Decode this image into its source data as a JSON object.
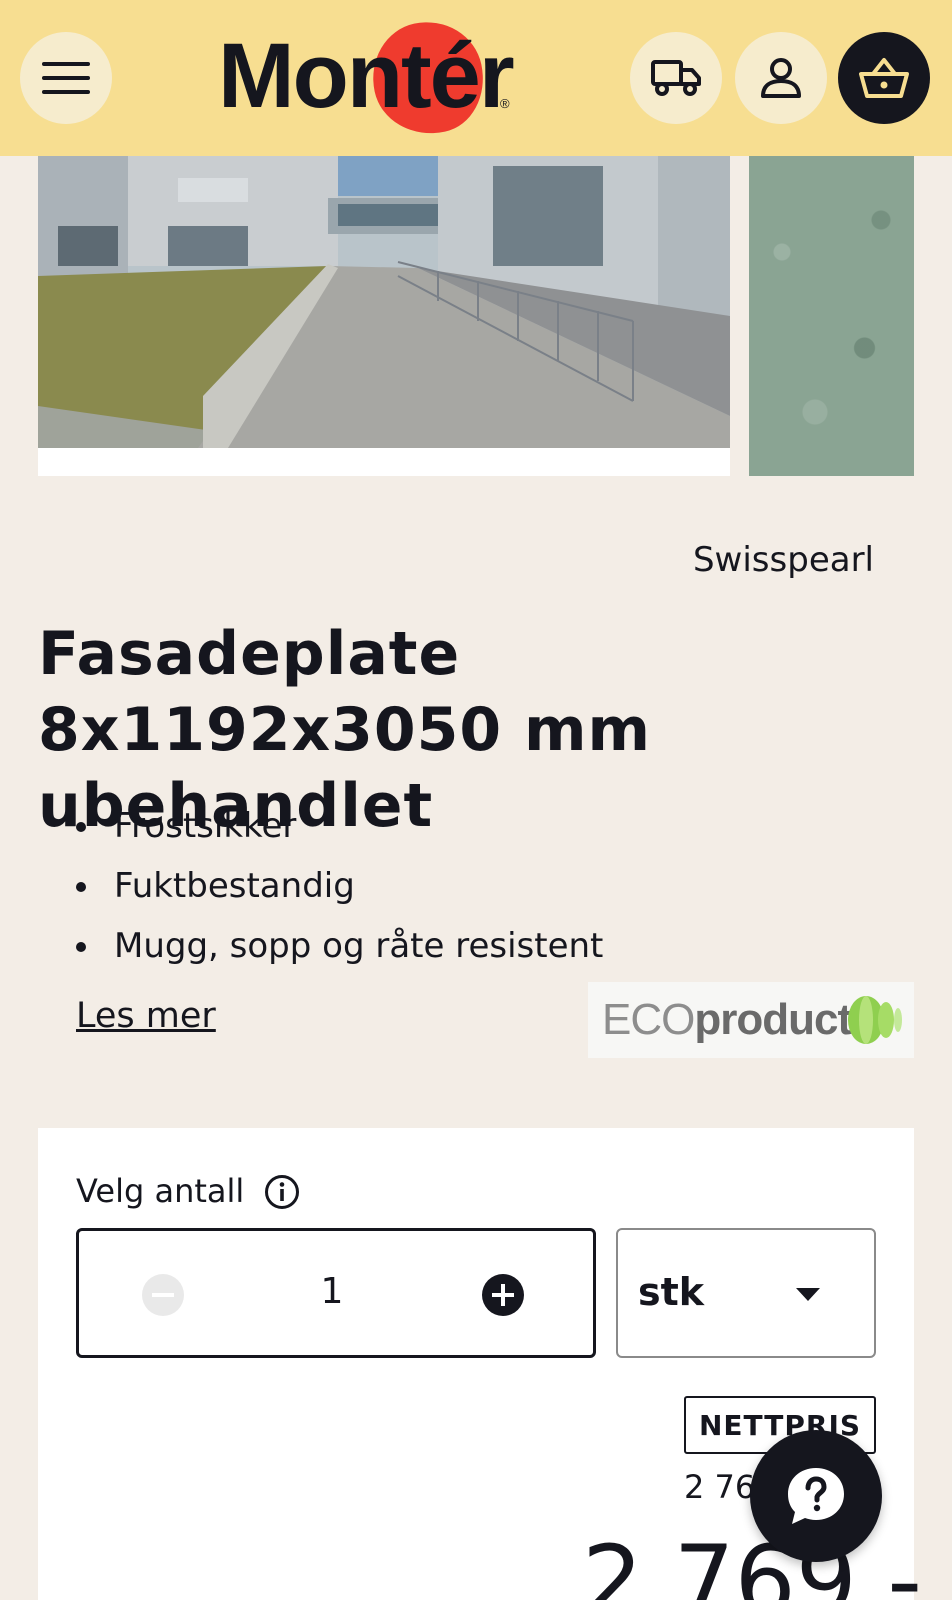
{
  "header": {
    "logo_text": "Montér",
    "logo_reg": "®",
    "menu_icon": "hamburger-icon",
    "delivery_icon": "truck-icon",
    "account_icon": "user-icon",
    "cart_icon": "basket-icon",
    "background": "#f7de91"
  },
  "gallery": {
    "images": [
      "building-photo",
      "texture-swatch"
    ]
  },
  "product": {
    "brand": "Swisspearl",
    "title": "Fasadeplate 8x1192x3050 mm ubehandlet",
    "features": [
      "Frostsikker",
      "Fuktbestandig",
      "Mugg, sopp og råte resistent"
    ],
    "read_more": "Les mer",
    "eco_badge": {
      "part1": "ECO",
      "part2": "product"
    }
  },
  "purchase": {
    "qty_label": "Velg antall",
    "quantity": "1",
    "unit": "stk",
    "net_price_badge": "NETTPRIS",
    "unit_price": "2 769,-",
    "price": "2 769,-"
  },
  "colors": {
    "accent_dark": "#15161e",
    "logo_red": "#ef3b2e",
    "page_bg": "#f3ede6"
  }
}
